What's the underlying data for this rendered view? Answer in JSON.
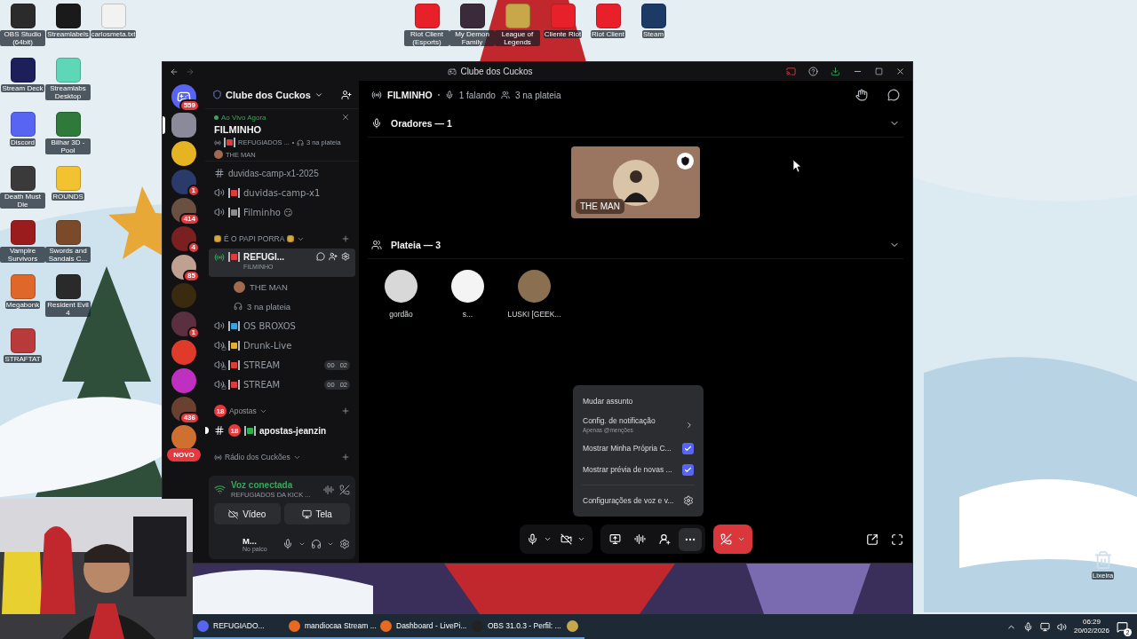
{
  "desktop": {
    "icon_columns": [
      {
        "icons": [
          {
            "label": "OBS Studio (64bit)",
            "color": "#2b2b2b"
          },
          {
            "label": "Stream Deck",
            "color": "#1d1f5a"
          },
          {
            "label": "Discord",
            "color": "#5865f2"
          },
          {
            "label": "Death Must Die",
            "color": "#3a3a3a"
          },
          {
            "label": "Vampire Survivors",
            "color": "#9b1c1c"
          },
          {
            "label": "Megabonk",
            "color": "#e0672a"
          },
          {
            "label": "STRAFTAT",
            "color": "#b83a3a"
          }
        ]
      },
      {
        "icons": [
          {
            "label": "Streamlabels",
            "color": "#1a1a1a"
          },
          {
            "label": "Streamlabs Desktop",
            "color": "#5ed6b8"
          },
          {
            "label": "Bilhar 3D - Pool",
            "color": "#2f7a3a"
          },
          {
            "label": "ROUNDS",
            "color": "#f2c230"
          },
          {
            "label": "Swords and Sandals C...",
            "color": "#7a4a2a"
          },
          {
            "label": "Resident Evil 4",
            "color": "#2a2a2a"
          }
        ]
      },
      {
        "icons": [
          {
            "label": "carlosmeta.txt",
            "color": "#f2f2f2"
          }
        ]
      }
    ],
    "top_icons": [
      {
        "label": "Riot Client (Esports)",
        "color": "#e8202a"
      },
      {
        "label": "My Demon Family",
        "color": "#3a2a3a"
      },
      {
        "label": "League of Legends",
        "color": "#c8a64a"
      },
      {
        "label": "Cliente Riot",
        "color": "#e8202a"
      },
      {
        "label": "Riot Client",
        "color": "#e8202a"
      },
      {
        "label": "Steam",
        "color": "#1b3a66"
      }
    ],
    "recycle_bin": {
      "label": "Lixeira"
    }
  },
  "window": {
    "title": "Clube dos Cuckos"
  },
  "servers": [
    {
      "kind": "home",
      "badge": "559",
      "selected": false,
      "color": "#5865f2"
    },
    {
      "kind": "server",
      "selected": true,
      "color": "#8a8a9a"
    },
    {
      "kind": "server",
      "selected": false,
      "color": "#e6b422"
    },
    {
      "kind": "server",
      "selected": false,
      "color": "#2a3a6a",
      "badge": "1"
    },
    {
      "kind": "server",
      "selected": false,
      "color": "#6a5040",
      "badge": "414"
    },
    {
      "kind": "server",
      "selected": false,
      "color": "#7a2020",
      "badge": "4"
    },
    {
      "kind": "server",
      "selected": false,
      "color": "#c0a090",
      "badge": "85"
    },
    {
      "kind": "server",
      "selected": false,
      "color": "#3a2a10"
    },
    {
      "kind": "server",
      "selected": false,
      "color": "#5a3040",
      "badge": "1"
    },
    {
      "kind": "server",
      "selected": false,
      "color": "#e03a2a"
    },
    {
      "kind": "server",
      "selected": false,
      "color": "#c030c0"
    },
    {
      "kind": "server",
      "selected": false,
      "color": "#6a4030",
      "badge": "436"
    },
    {
      "kind": "server",
      "selected": false,
      "color": "#d07030"
    }
  ],
  "new_pill": "NOVO",
  "server_header": {
    "name": "Clube dos Cuckos"
  },
  "live_card": {
    "label": "Ao Vivo Agora",
    "title": "FILMINHO",
    "channel": "REFUGIADOS ...",
    "audience": "3 na plateia",
    "host": "THE MAN"
  },
  "channels": [
    {
      "kind": "text",
      "name": "duvidas-camp-x1-2025",
      "unread": false
    },
    {
      "kind": "voice",
      "name": "duvidas-camp-x1",
      "color": "#e03a3a",
      "locked": false
    },
    {
      "kind": "voice",
      "name": "Filminho 😏",
      "color": "#8a8a8a",
      "locked": false
    },
    {
      "kind": "money_category",
      "name": "É O PAPI PORRA"
    },
    {
      "kind": "stage",
      "name": "REFUGI...",
      "subtitle": "FILMINHO",
      "color": "#e03a3a",
      "selected": true,
      "members": [
        {
          "kind": "user",
          "name": "THE MAN"
        },
        {
          "kind": "audience",
          "name": "3 na plateia"
        }
      ]
    },
    {
      "kind": "voice",
      "name": "OS BROXOS",
      "color": "#3aa0e0",
      "locked": false
    },
    {
      "kind": "voice",
      "name": "Drunk-Live",
      "color": "#e0b030",
      "locked": true
    },
    {
      "kind": "voice",
      "name": "STREAM",
      "color": "#e03a3a",
      "locked": true,
      "counts": [
        "00",
        "02"
      ]
    },
    {
      "kind": "voice",
      "name": "STREAM",
      "color": "#e03a3a",
      "locked": true,
      "counts": [
        "00",
        "02"
      ]
    },
    {
      "kind": "category",
      "name": "Apostas",
      "prefix": "18"
    },
    {
      "kind": "text",
      "name": "apostas-jeanzin",
      "prefix": "18",
      "color": "#2eae4a",
      "unread": true
    },
    {
      "kind": "radio_category",
      "name": "Rádio dos Cuckões"
    }
  ],
  "voice_panel": {
    "status": "Voz conectada",
    "channel": "REFUGIADOS DA KICK ...",
    "buttons": [
      {
        "kind": "video",
        "label": "Vídeo"
      },
      {
        "kind": "screen",
        "label": "Tela"
      }
    ]
  },
  "user": {
    "name": "M...",
    "status": "No palco"
  },
  "main": {
    "header": {
      "title": "FILMINHO",
      "speaking": "1 falando",
      "audience": "3 na plateia"
    },
    "speakers": {
      "title": "Oradores — 1",
      "expanded": true,
      "cards": [
        {
          "name": "THE MAN",
          "moderator": true
        }
      ]
    },
    "audience": {
      "title": "Plateia — 3",
      "expanded": true,
      "members": [
        {
          "name": "gordão",
          "color": "#d8d8d8"
        },
        {
          "name": "s...",
          "color": "#f4f4f4"
        },
        {
          "name": "LUSKI [GEEK...",
          "color": "#8a7050"
        }
      ]
    },
    "menu": {
      "items": [
        {
          "kind": "action",
          "label": "Mudar assunto"
        },
        {
          "kind": "submenu",
          "label": "Config. de notificação",
          "hint": "Apenas @menções"
        },
        {
          "kind": "checkbox",
          "label": "Mostrar Minha Própria C...",
          "checked": true
        },
        {
          "kind": "checkbox",
          "label": "Mostrar prévia de novas ...",
          "checked": true
        },
        {
          "kind": "settings",
          "label": "Configurações de voz e v..."
        }
      ]
    },
    "call_controls": [
      {
        "buttons": [
          {
            "kind": "mic",
            "dropdown": true,
            "selected": false
          },
          {
            "kind": "camera_off",
            "dropdown": true,
            "selected": false
          }
        ]
      },
      {
        "buttons": [
          {
            "kind": "screen_share",
            "dropdown": false,
            "selected": false
          },
          {
            "kind": "soundboard",
            "dropdown": false,
            "selected": false
          },
          {
            "kind": "invite",
            "dropdown": false,
            "selected": false
          },
          {
            "kind": "more",
            "dropdown": false,
            "selected": true
          }
        ]
      },
      {
        "buttons": [
          {
            "kind": "hang_up",
            "dropdown": true,
            "selected": false
          }
        ]
      }
    ],
    "view_controls": [
      {
        "kind": "popout"
      },
      {
        "kind": "fullscreen"
      }
    ]
  },
  "taskbar": {
    "items": [
      {
        "kind": "discord",
        "label": "REFUGIADO..."
      },
      {
        "kind": "firefox",
        "label": "mandiocaa Stream ..."
      },
      {
        "kind": "firefox",
        "label": "Dashboard - LivePi..."
      },
      {
        "kind": "obs",
        "label": "OBS 31.0.3 - Perfil: ..."
      },
      {
        "kind": "league"
      }
    ],
    "time": "06:29",
    "date": "20/02/2026",
    "notifications": "2"
  }
}
